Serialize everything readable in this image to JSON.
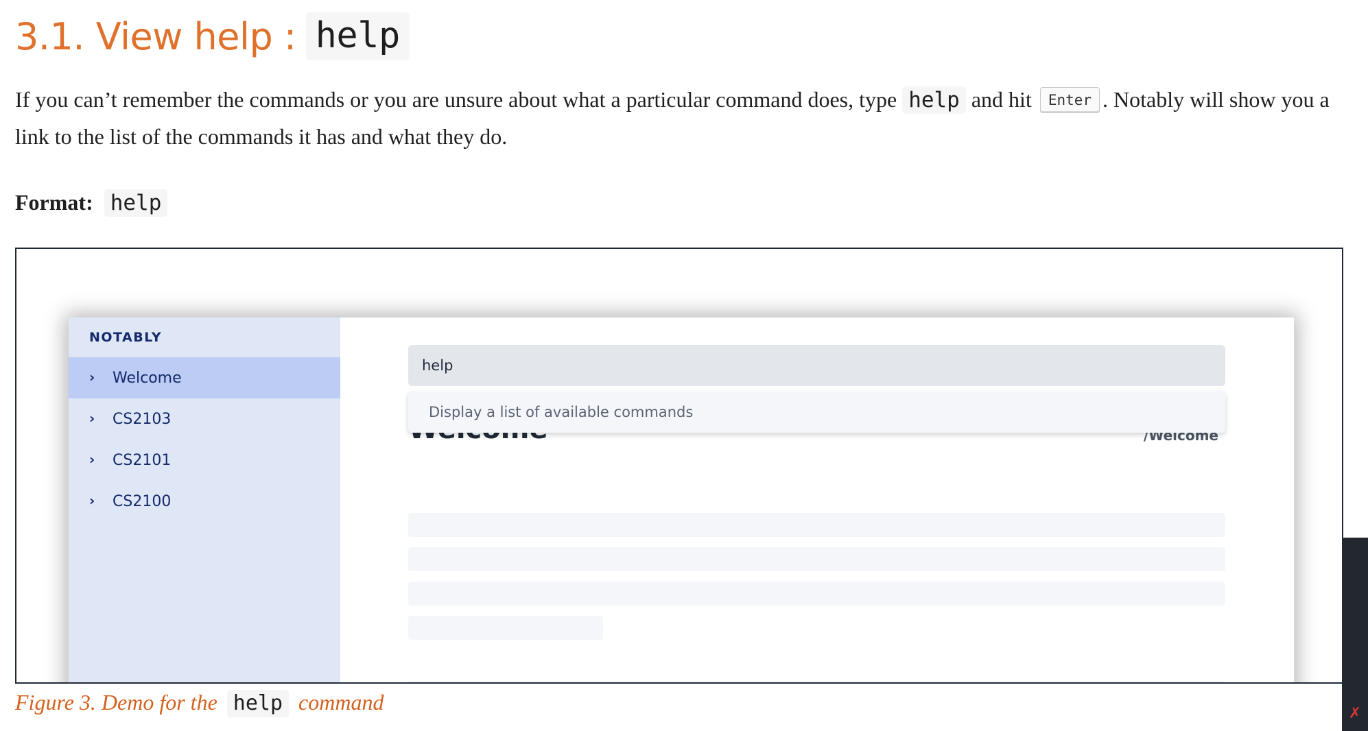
{
  "heading": {
    "text": "3.1. View help :",
    "code": "help"
  },
  "paragraph": {
    "part1": "If you can’t remember the commands or you are unsure about what a particular command does, type",
    "code": "help",
    "part2": "and hit",
    "key": "Enter",
    "part3": ". Notably will show you a link to the list of the commands it has and what they do."
  },
  "format": {
    "label": "Format:",
    "code": "help"
  },
  "app": {
    "brand": "NOTABLY",
    "nav": [
      {
        "label": "Welcome",
        "active": true
      },
      {
        "label": "CS2103",
        "active": false
      },
      {
        "label": "CS2101",
        "active": false
      },
      {
        "label": "CS2100",
        "active": false
      }
    ],
    "command_input": {
      "value": "help"
    },
    "suggestion": "Display a list of available commands",
    "page_title": "Welcome",
    "page_path": "/Welcome"
  },
  "caption": {
    "part1": "Figure 3. Demo for the",
    "code": "help",
    "part2": "command"
  },
  "colors": {
    "heading": "#e0712a",
    "caption": "#d4621e",
    "sidebar_bg": "#dfe7f7",
    "sidebar_active": "#bcccf4",
    "nav_text": "#142a6b"
  },
  "icons": {
    "nav_item": "chevron-right-icon",
    "edge_widget": "mic-off-icon"
  }
}
